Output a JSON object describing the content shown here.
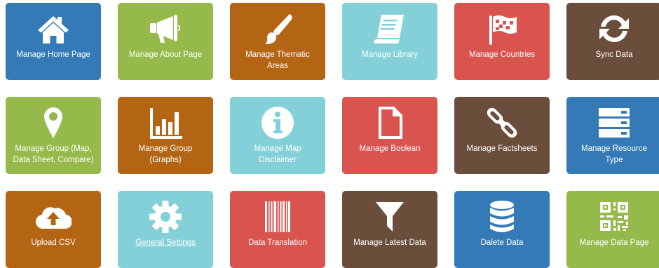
{
  "tiles": [
    {
      "label": "Manage Home Page",
      "icon": "home-icon",
      "color": "#337ab7"
    },
    {
      "label": "Manage About Page",
      "icon": "megaphone-icon",
      "color": "#95b94b"
    },
    {
      "label": "Manage Thematic Areas",
      "icon": "paintbrush-icon",
      "color": "#b46514"
    },
    {
      "label": "Manage Library",
      "icon": "book-icon",
      "color": "#84d0d8"
    },
    {
      "label": "Manage Countries",
      "icon": "flag-icon",
      "color": "#d9534f"
    },
    {
      "label": "Sync Data",
      "icon": "sync-icon",
      "color": "#6b4d3c"
    },
    {
      "label": "Manage Group (Map, Data Sheet, Compare)",
      "icon": "map-marker-icon",
      "color": "#95b94b"
    },
    {
      "label": "Manage Group (Graphs)",
      "icon": "bar-chart-icon",
      "color": "#b46514"
    },
    {
      "label": "Manage Map Disclaimer",
      "icon": "info-icon",
      "color": "#84d0d8"
    },
    {
      "label": "Manage Boolean",
      "icon": "file-icon",
      "color": "#d9534f"
    },
    {
      "label": "Manage Factsheets",
      "icon": "chain-link-icon",
      "color": "#6b4d3c"
    },
    {
      "label": "Manage Resource Type",
      "icon": "server-icon",
      "color": "#337ab7"
    },
    {
      "label": "Upload CSV",
      "icon": "cloud-upload-icon",
      "color": "#b46514"
    },
    {
      "label": "General Settings",
      "icon": "gear-icon",
      "color": "#84d0d8"
    },
    {
      "label": "Data Translation",
      "icon": "barcode-icon",
      "color": "#d9534f"
    },
    {
      "label": "Manage Latest Data",
      "icon": "filter-icon",
      "color": "#6b4d3c"
    },
    {
      "label": "Dalete Data",
      "icon": "database-icon",
      "color": "#337ab7"
    },
    {
      "label": "Manage Data Page",
      "icon": "qrcode-icon",
      "color": "#95b94b"
    }
  ]
}
